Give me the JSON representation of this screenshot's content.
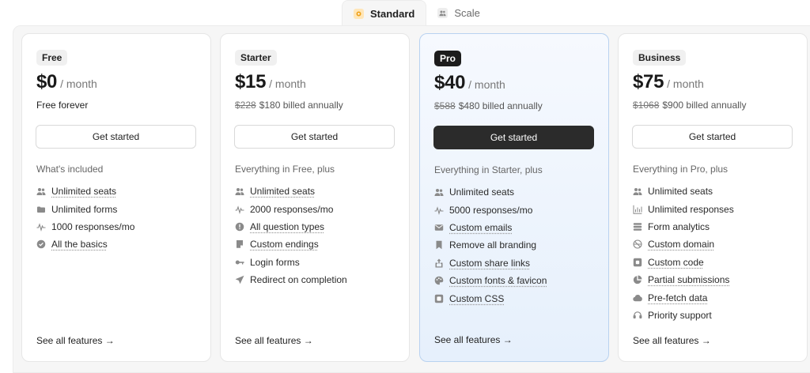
{
  "tabs": [
    {
      "label": "Standard",
      "icon": "spark-icon",
      "active": true
    },
    {
      "label": "Scale",
      "icon": "team-icon",
      "active": false
    }
  ],
  "plans": [
    {
      "badge": "Free",
      "price": "$0",
      "per": "/ month",
      "strike": "",
      "billed": "Free forever",
      "cta": "Get started",
      "included": "What's included",
      "features": [
        {
          "label": "Unlimited seats",
          "icon": "users-icon"
        },
        {
          "label": "Unlimited forms",
          "icon": "folder-icon"
        },
        {
          "label": "1000 responses/mo",
          "icon": "activity-icon"
        },
        {
          "label": "All the basics",
          "icon": "check-circle-icon"
        }
      ],
      "see_all": "See all features →"
    },
    {
      "badge": "Starter",
      "price": "$15",
      "per": "/ month",
      "strike": "$228",
      "billed": "$180 billed annually",
      "cta": "Get started",
      "included": "Everything in Free, plus",
      "features": [
        {
          "label": "Unlimited seats",
          "icon": "users-icon"
        },
        {
          "label": "2000 responses/mo",
          "icon": "activity-icon"
        },
        {
          "label": "All question types",
          "icon": "info-icon"
        },
        {
          "label": "Custom endings",
          "icon": "note-icon"
        },
        {
          "label": "Login forms",
          "icon": "key-icon"
        },
        {
          "label": "Redirect on completion",
          "icon": "send-icon"
        }
      ],
      "see_all": "See all features →"
    },
    {
      "badge": "Pro",
      "price": "$40",
      "per": "/ month",
      "strike": "$588",
      "billed": "$480 billed annually",
      "cta": "Get started",
      "included": "Everything in Starter, plus",
      "features": [
        {
          "label": "Unlimited seats",
          "icon": "users-icon"
        },
        {
          "label": "5000 responses/mo",
          "icon": "activity-icon"
        },
        {
          "label": "Custom emails",
          "icon": "mail-icon"
        },
        {
          "label": "Remove all branding",
          "icon": "bookmark-icon"
        },
        {
          "label": "Custom share links",
          "icon": "share-icon"
        },
        {
          "label": "Custom fonts & favicon",
          "icon": "palette-icon"
        },
        {
          "label": "Custom CSS",
          "icon": "css-icon"
        }
      ],
      "see_all": "See all features →"
    },
    {
      "badge": "Business",
      "price": "$75",
      "per": "/ month",
      "strike": "$1068",
      "billed": "$900 billed annually",
      "cta": "Get started",
      "included": "Everything in Pro, plus",
      "features": [
        {
          "label": "Unlimited seats",
          "icon": "users-icon"
        },
        {
          "label": "Unlimited responses",
          "icon": "bar-chart-icon"
        },
        {
          "label": "Form analytics",
          "icon": "analytics-icon"
        },
        {
          "label": "Custom domain",
          "icon": "globe-icon"
        },
        {
          "label": "Custom code",
          "icon": "code-icon"
        },
        {
          "label": "Partial submissions",
          "icon": "pie-icon"
        },
        {
          "label": "Pre-fetch data",
          "icon": "cloud-icon"
        },
        {
          "label": "Priority support",
          "icon": "headset-icon"
        }
      ],
      "see_all": "See all features →"
    }
  ],
  "colors": {
    "accent_pro": "#2b2b2b",
    "pro_border": "#b9d2f0",
    "icon_grey": "#8a8a8a"
  }
}
